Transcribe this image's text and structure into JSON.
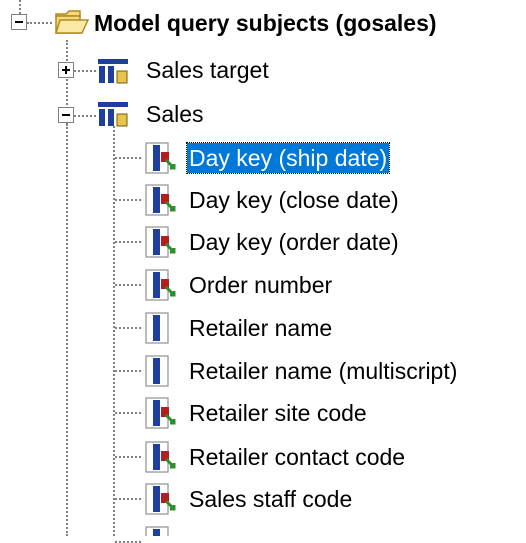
{
  "tree": {
    "root": {
      "label": "Model query subjects (gosales)",
      "expanded": true,
      "icon": "folder-icon"
    },
    "children": [
      {
        "label": "Sales target",
        "expanded": false,
        "icon": "query-subject-icon"
      },
      {
        "label": "Sales",
        "expanded": true,
        "icon": "query-subject-icon",
        "items": [
          {
            "label": "Day key (ship date)",
            "icon": "identifier-icon",
            "selected": true
          },
          {
            "label": "Day key (close date)",
            "icon": "identifier-icon"
          },
          {
            "label": "Day key (order date)",
            "icon": "identifier-icon"
          },
          {
            "label": "Order number",
            "icon": "identifier-icon"
          },
          {
            "label": "Retailer name",
            "icon": "attribute-icon"
          },
          {
            "label": "Retailer name (multiscript)",
            "icon": "attribute-icon"
          },
          {
            "label": "Retailer site code",
            "icon": "identifier-icon"
          },
          {
            "label": "Retailer contact code",
            "icon": "identifier-icon"
          },
          {
            "label": "Sales staff code",
            "icon": "identifier-icon"
          },
          {
            "label": "",
            "icon": "identifier-icon"
          }
        ]
      }
    ]
  },
  "colors": {
    "selection": "#0078d7",
    "folder": "#f5d97a",
    "icon_blue": "#1f3f9f",
    "icon_green": "#2f8f2f"
  }
}
